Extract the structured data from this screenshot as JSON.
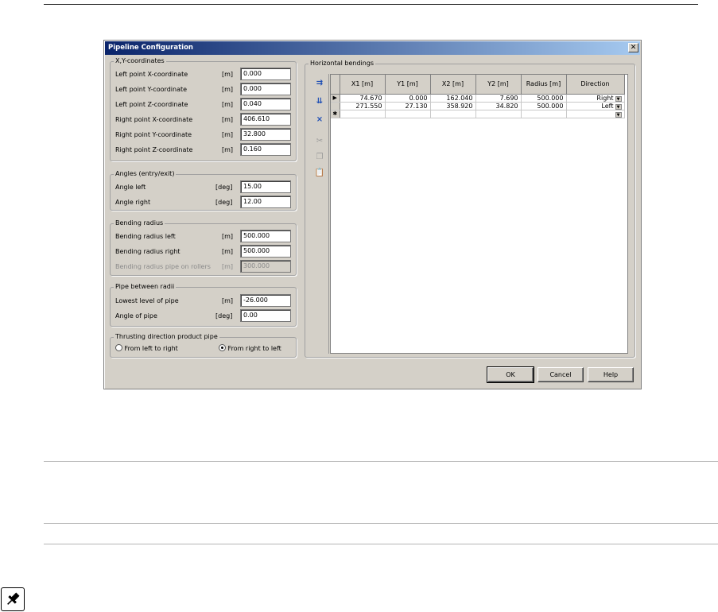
{
  "dialog": {
    "title": "Pipeline Configuration",
    "close_label": "✕"
  },
  "xy": {
    "legend": "X,Y-coordinates",
    "rows": [
      {
        "label": "Left point X-coordinate",
        "unit": "[m]",
        "value": "0.000"
      },
      {
        "label": "Left point Y-coordinate",
        "unit": "[m]",
        "value": "0.000"
      },
      {
        "label": "Left point Z-coordinate",
        "unit": "[m]",
        "value": "0.040"
      },
      {
        "label": "Right point X-coordinate",
        "unit": "[m]",
        "value": "406.610"
      },
      {
        "label": "Right point Y-coordinate",
        "unit": "[m]",
        "value": "32.800"
      },
      {
        "label": "Right point Z-coordinate",
        "unit": "[m]",
        "value": "0.160"
      }
    ]
  },
  "angles": {
    "legend": "Angles (entry/exit)",
    "rows": [
      {
        "label": "Angle left",
        "unit": "[deg]",
        "value": "15.00"
      },
      {
        "label": "Angle right",
        "unit": "[deg]",
        "value": "12.00"
      }
    ]
  },
  "bending": {
    "legend": "Bending radius",
    "rows": [
      {
        "label": "Bending radius left",
        "unit": "[m]",
        "value": "500.000"
      },
      {
        "label": "Bending radius right",
        "unit": "[m]",
        "value": "500.000"
      },
      {
        "label": "Bending radius pipe on rollers",
        "unit": "[m]",
        "value": "300.000"
      }
    ]
  },
  "pipe": {
    "legend": "Pipe between radii",
    "rows": [
      {
        "label": "Lowest level of pipe",
        "unit": "[m]",
        "value": "-26.000"
      },
      {
        "label": "Angle of pipe",
        "unit": "[deg]",
        "value": "0.00"
      }
    ]
  },
  "thrust": {
    "legend": "Thrusting direction product pipe",
    "option_left": "From left to right",
    "option_right": "From right to left",
    "selected": "From right to left"
  },
  "horizontal": {
    "legend": "Horizontal bendings",
    "columns": [
      "X1 [m]",
      "Y1 [m]",
      "X2 [m]",
      "Y2 [m]",
      "Radius [m]",
      "Direction"
    ],
    "rows": [
      [
        "74.670",
        "0.000",
        "162.040",
        "7.690",
        "500.000",
        "Right"
      ],
      [
        "271.550",
        "27.130",
        "358.920",
        "34.820",
        "500.000",
        "Left"
      ]
    ],
    "current_marker": "▶",
    "new_row_marker": "✱",
    "dropdown_glyph": "▼"
  },
  "toolbar_icons": [
    "insert-row-icon",
    "insert-row-below-icon",
    "delete-row-icon",
    "cut-icon",
    "copy-icon",
    "paste-icon"
  ],
  "buttons": {
    "ok": "OK",
    "cancel": "Cancel",
    "help": "Help"
  },
  "colors": {
    "titlebar_start": "#0a246a",
    "titlebar_end": "#a6caf0",
    "dialog_bg": "#d4d0c8"
  }
}
